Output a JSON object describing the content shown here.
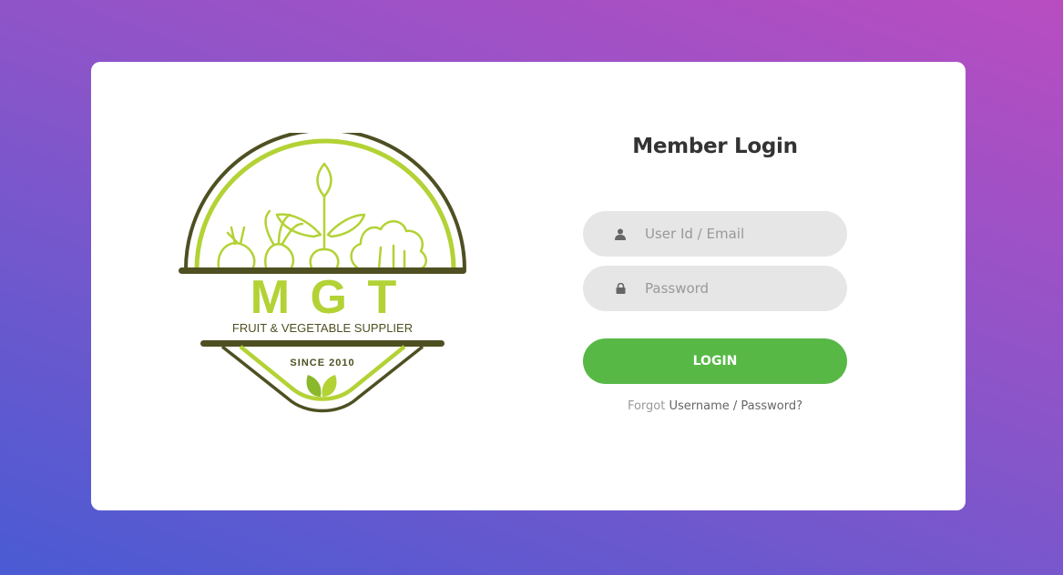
{
  "colors": {
    "bg_start": "#4a5bd3",
    "bg_end": "#b84dc1",
    "button": "#57b846",
    "logo_green": "#b3d235",
    "logo_dark": "#4f5022"
  },
  "logo": {
    "letters": "M G T",
    "tagline": "FRUIT & VEGETABLE SUPPLIER",
    "since": "SINCE 2010"
  },
  "login": {
    "title": "Member Login",
    "username_placeholder": "User Id / Email",
    "username_value": "",
    "password_placeholder": "Password",
    "password_value": "",
    "button_label": "LOGIN",
    "forgot_prefix": "Forgot",
    "forgot_link": "Username / Password?",
    "user_icon": "user-icon",
    "lock_icon": "lock-icon"
  }
}
